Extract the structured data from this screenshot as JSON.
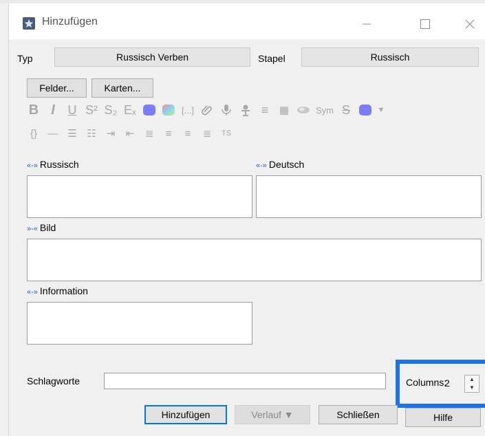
{
  "window": {
    "title": "Hinzufügen",
    "app_icon": "star-icon"
  },
  "titlebar_controls": {
    "minimize_icon": "minimize-icon",
    "maximize_icon": "maximize-icon",
    "close_icon": "close-icon"
  },
  "type_row": {
    "type_label": "Typ",
    "type_value": "Russisch Verben",
    "deck_label": "Stapel",
    "deck_value": "Russisch"
  },
  "buttons_row": {
    "fields_label": "Felder...",
    "cards_label": "Karten..."
  },
  "toolbar": {
    "row1": [
      {
        "name": "bold-icon",
        "glyph": "B"
      },
      {
        "name": "italic-icon",
        "glyph": "I"
      },
      {
        "name": "underline-icon",
        "glyph": "U"
      },
      {
        "name": "superscript-icon",
        "glyph": "S²"
      },
      {
        "name": "subscript-icon",
        "glyph": "S₂"
      },
      {
        "name": "clear-format-icon",
        "glyph": "Eₓ"
      },
      {
        "name": "text-color-icon",
        "glyph": "●"
      },
      {
        "name": "highlight-color-icon",
        "glyph": "●"
      },
      {
        "name": "cloze-icon",
        "glyph": "[...]"
      },
      {
        "name": "attach-icon",
        "glyph": "🔗"
      },
      {
        "name": "record-audio-icon",
        "glyph": "🎤"
      },
      {
        "name": "mathjax-icon",
        "glyph": "♆"
      },
      {
        "name": "html-editor-icon",
        "glyph": "≡"
      },
      {
        "name": "table-icon",
        "glyph": "▦"
      },
      {
        "name": "eraser-icon",
        "glyph": "✎"
      },
      {
        "name": "symbol-icon",
        "glyph": "Sym"
      },
      {
        "name": "strikethrough-icon",
        "glyph": "S̶"
      },
      {
        "name": "color-swatch-icon",
        "glyph": "●"
      },
      {
        "name": "dropdown-arrow-icon",
        "glyph": "▼"
      }
    ],
    "row2": [
      {
        "name": "curly-braces-icon",
        "glyph": "{}"
      },
      {
        "name": "horizontal-rule-icon",
        "glyph": "—"
      },
      {
        "name": "bullet-list-icon",
        "glyph": "☰"
      },
      {
        "name": "numbered-list-icon",
        "glyph": "☷"
      },
      {
        "name": "indent-icon",
        "glyph": "⇥"
      },
      {
        "name": "outdent-icon",
        "glyph": "⇤"
      },
      {
        "name": "align-center-icon",
        "glyph": "≣"
      },
      {
        "name": "align-left-icon",
        "glyph": "≡"
      },
      {
        "name": "align-right-icon",
        "glyph": "≡"
      },
      {
        "name": "justify-icon",
        "glyph": "≣"
      },
      {
        "name": "ts-icon",
        "glyph": "TS"
      }
    ]
  },
  "fields": {
    "russian_label": "Russisch",
    "german_label": "Deutsch",
    "image_label": "Bild",
    "info_label": "Information",
    "marker_sticky": "«-»",
    "marker_nonsticky": "»-«"
  },
  "tags": {
    "label": "Schlagworte",
    "value": ""
  },
  "columns": {
    "label": "Columns:",
    "value": "2"
  },
  "actions": {
    "add_label": "Hinzufügen",
    "history_label": "Verlauf ▼",
    "close_label": "Schließen",
    "help_label": "Hilfe"
  },
  "colors": {
    "accent": "#1a73e8",
    "cloze_marker": "#2b5fb3",
    "text_color_swatch": "#6f6ff0",
    "highlight_gradient": "#f07070"
  }
}
